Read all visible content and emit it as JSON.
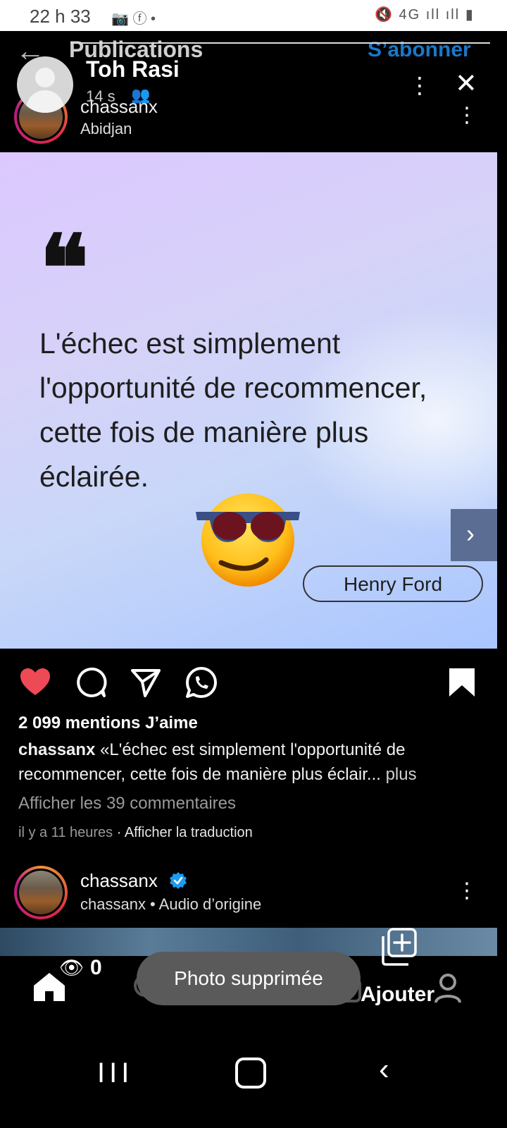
{
  "status_bar": {
    "time": "22 h 33",
    "left_icons": "📷 ⓕ •",
    "right_icons": "🔇 4G ıll ıll ▮"
  },
  "ig_header": {
    "back_icon": "arrow-left-icon",
    "title": "Publications",
    "subscribe": "S’abonner"
  },
  "viewer": {
    "name": "Toh Rasi",
    "time": "14 s",
    "group_icon": "👥",
    "more_icon": "⋮",
    "close_icon": "✕"
  },
  "post": {
    "username": "chassanx",
    "location": "Abidjan",
    "more_icon": "⋮",
    "quote_mark": "❝",
    "quote": "L'échec est simplement l'opportunité de recommencer, cette fois de manière plus éclairée.",
    "author": "Henry Ford",
    "next_icon": "›",
    "likes": "2 099 mentions J’aime",
    "caption_user": "chassanx",
    "caption_text": " «L'échec est simplement l'opportunité de recommencer, cette fois de manière plus éclair...",
    "caption_more": " plus",
    "comments_link": "Afficher les 39 commentaires",
    "time_ago": "il y a 11 heures",
    "translate": " · Afficher la traduction"
  },
  "next_post": {
    "username": "chassanx",
    "subtitle": "chassanx • Audio d’origine",
    "more_icon": "⋮"
  },
  "overlay": {
    "eye_icon": "👁",
    "views": "0",
    "add_label": "Ajouter",
    "toast": "Photo supprimée"
  },
  "system_nav": {
    "recent": "III",
    "back": "‹"
  },
  "colors": {
    "accent_blue": "#1a78c8",
    "like_red": "#ed4956",
    "verified_blue": "#1d9bf0"
  }
}
